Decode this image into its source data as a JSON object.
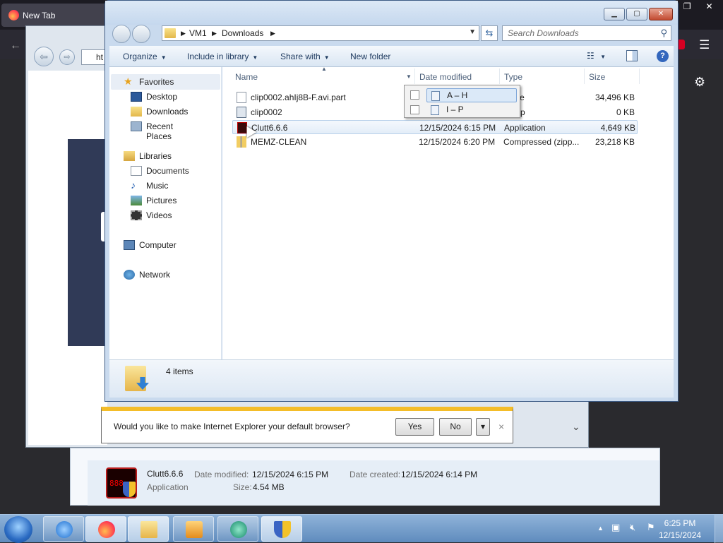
{
  "firefox": {
    "tab_title": "New Tab",
    "win_buttons": [
      "–",
      "❐",
      "✕"
    ],
    "menu_icon": "☰",
    "back_icon": "←",
    "gear_icon": "⚙"
  },
  "ie": {
    "address_fragment": "ht",
    "notification": {
      "message": "Would you like to make Internet Explorer your default browser?",
      "yes_label": "Yes",
      "no_label": "No",
      "close_label": "×",
      "dropdown_label": "▾"
    }
  },
  "explorer": {
    "breadcrumb": [
      "VM1",
      "Downloads"
    ],
    "search_placeholder": "Search Downloads",
    "toolbar": {
      "organize": "Organize",
      "include_in_library": "Include in library",
      "share_with": "Share with",
      "new_folder": "New folder"
    },
    "nav": {
      "favorites": "Favorites",
      "desktop": "Desktop",
      "downloads": "Downloads",
      "recent_places": "Recent Places",
      "libraries": "Libraries",
      "documents": "Documents",
      "music": "Music",
      "pictures": "Pictures",
      "videos": "Videos",
      "computer": "Computer",
      "network": "Network"
    },
    "columns": {
      "name": "Name",
      "date_modified": "Date modified",
      "type": "Type",
      "size": "Size"
    },
    "files": [
      {
        "name": "clip0002.ahIj8B-F.avi.part",
        "date": "",
        "type": "T File",
        "size": "34,496 KB"
      },
      {
        "name": "clip0002",
        "date": "",
        "type": "o Clip",
        "size": "0 KB"
      },
      {
        "name": "Clutt6.6.6",
        "date": "12/15/2024 6:15 PM",
        "type": "Application",
        "size": "4,649 KB"
      },
      {
        "name": "MEMZ-CLEAN",
        "date": "12/15/2024 6:20 PM",
        "type": "Compressed (zipp...",
        "size": "23,218 KB"
      }
    ],
    "filter_options": [
      "A – H",
      "I – P"
    ],
    "status": "4 items"
  },
  "details": {
    "name": "Clutt6.6.6",
    "type": "Application",
    "date_modified_label": "Date modified:",
    "date_modified": "12/15/2024 6:15 PM",
    "date_created_label": "Date created:",
    "date_created": "12/15/2024 6:14 PM",
    "size_label": "Size:",
    "size": "4.54 MB"
  },
  "taskbar": {
    "time": "6:25 PM",
    "date": "12/15/2024"
  }
}
